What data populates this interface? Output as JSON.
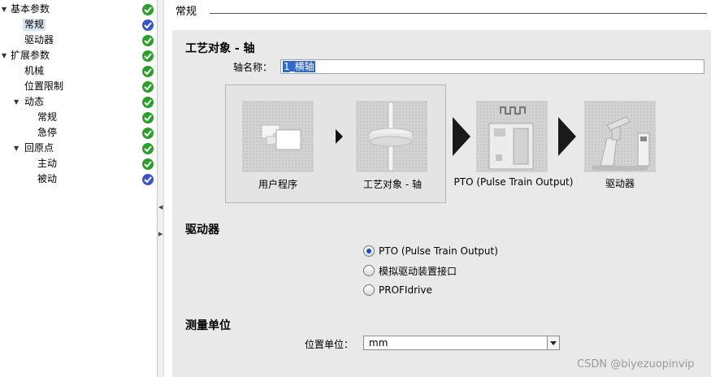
{
  "tree": {
    "items": [
      {
        "label": "基本参数",
        "expand": "▼",
        "status": "ok"
      },
      {
        "label": "常规",
        "expand": "",
        "status": "edit"
      },
      {
        "label": "驱动器",
        "expand": "",
        "status": "ok"
      },
      {
        "label": "扩展参数",
        "expand": "▼",
        "status": "ok"
      },
      {
        "label": "机械",
        "expand": "",
        "status": "ok"
      },
      {
        "label": "位置限制",
        "expand": "",
        "status": "ok"
      },
      {
        "label": "动态",
        "expand": "▼",
        "status": "ok"
      },
      {
        "label": "常规",
        "expand": "",
        "status": "ok"
      },
      {
        "label": "急停",
        "expand": "",
        "status": "ok"
      },
      {
        "label": "回原点",
        "expand": "▼",
        "status": "ok"
      },
      {
        "label": "主动",
        "expand": "",
        "status": "ok"
      },
      {
        "label": "被动",
        "expand": "",
        "status": "edit"
      }
    ]
  },
  "splitter": {
    "collapse_glyph": "◀",
    "expand_glyph": "▶"
  },
  "section": {
    "title": "常规"
  },
  "tech_object": {
    "title": "工艺对象 - 轴",
    "name_label": "轴名称：",
    "name_value": "1_横轴"
  },
  "flow": {
    "user_program": "用户程序",
    "tech_object": "工艺对象 - 轴",
    "pto": "PTO (Pulse Train Output)",
    "drive": "驱动器"
  },
  "drive_section": {
    "title": "驱动器",
    "options": [
      {
        "label": "PTO (Pulse Train Output)",
        "checked": true
      },
      {
        "label": "模拟驱动装置接口",
        "checked": false
      },
      {
        "label": "PROFIdrive",
        "checked": false
      }
    ]
  },
  "units": {
    "title": "测量单位",
    "position_label": "位置单位：",
    "position_value": "mm"
  },
  "watermark": "CSDN @biyezuopinvip",
  "colors": {
    "status_ok": "#2aa02a",
    "status_edit": "#3a55c8",
    "selection": "#3169c6"
  }
}
